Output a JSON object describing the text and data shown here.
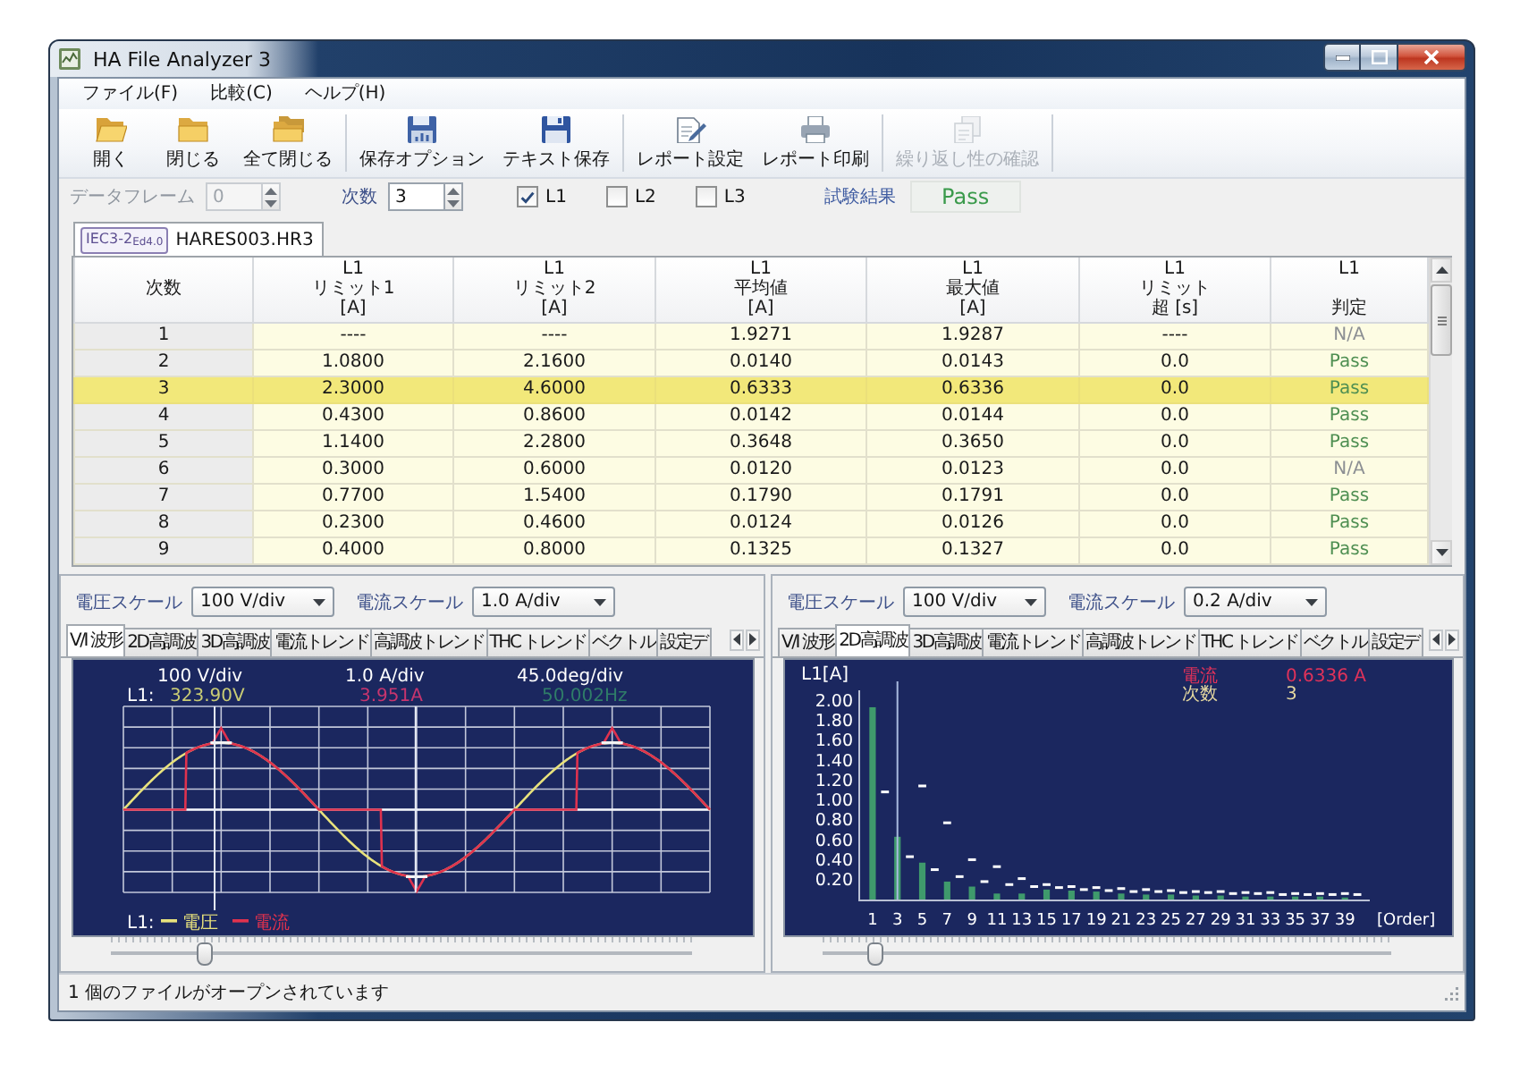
{
  "window": {
    "title": "HA File Analyzer 3"
  },
  "menu": [
    {
      "label": "ファイル(F)"
    },
    {
      "label": "比較(C)"
    },
    {
      "label": "ヘルプ(H)"
    }
  ],
  "toolbar": [
    {
      "buttons": [
        {
          "label": "開く",
          "kind": "open",
          "disabled": false
        },
        {
          "label": "閉じる",
          "kind": "folder",
          "disabled": false
        },
        {
          "label": "全て閉じる",
          "kind": "folders",
          "disabled": false
        }
      ]
    },
    {
      "buttons": [
        {
          "label": "保存オプション",
          "kind": "saveopt",
          "disabled": false
        },
        {
          "label": "テキスト保存",
          "kind": "save",
          "disabled": false
        }
      ]
    },
    {
      "buttons": [
        {
          "label": "レポート設定",
          "kind": "report",
          "disabled": false
        },
        {
          "label": "レポート印刷",
          "kind": "print",
          "disabled": false
        }
      ]
    },
    {
      "buttons": [
        {
          "label": "繰り返し性の確認",
          "kind": "repeat",
          "disabled": true
        }
      ]
    }
  ],
  "options": {
    "frame": {
      "label": "データフレーム",
      "value": "0",
      "disabled": true
    },
    "order": {
      "label": "次数",
      "value": "3",
      "disabled": false
    },
    "lines": [
      {
        "label": "L1",
        "checked": true
      },
      {
        "label": "L2",
        "checked": false
      },
      {
        "label": "L3",
        "checked": false
      }
    ],
    "result": {
      "label": "試験結果",
      "value": "Pass"
    }
  },
  "file_tabs": [
    {
      "standard": "IEC3-2$_{Ed4.0}$",
      "label": "HARES003.HR3",
      "selected": true
    }
  ],
  "table": {
    "columns": [
      {
        "lines": [
          "次数"
        ]
      },
      {
        "lines": [
          "L1",
          "リミット1",
          "[A]"
        ]
      },
      {
        "lines": [
          "L1",
          "リミット2",
          "[A]"
        ]
      },
      {
        "lines": [
          "L1",
          "平均値",
          "[A]"
        ]
      },
      {
        "lines": [
          "L1",
          "最大値",
          "[A]"
        ]
      },
      {
        "lines": [
          "L1",
          "リミット",
          "超 [s]"
        ]
      },
      {
        "lines": [
          "L1",
          "判定"
        ]
      }
    ],
    "rows": [
      {
        "cells": [
          "1",
          "----",
          "----",
          "1.9271",
          "1.9287",
          "----",
          "N/A"
        ],
        "color": "#8c8f93",
        "selected": false
      },
      {
        "cells": [
          "2",
          "1.0800",
          "2.1600",
          "0.0140",
          "0.0143",
          "0.0",
          "Pass"
        ],
        "color": "#4f8f52",
        "selected": false
      },
      {
        "cells": [
          "3",
          "2.3000",
          "4.6000",
          "0.6333",
          "0.6336",
          "0.0",
          "Pass"
        ],
        "color": "#4f8f52",
        "selected": true
      },
      {
        "cells": [
          "4",
          "0.4300",
          "0.8600",
          "0.0142",
          "0.0144",
          "0.0",
          "Pass"
        ],
        "color": "#4f8f52",
        "selected": false
      },
      {
        "cells": [
          "5",
          "1.1400",
          "2.2800",
          "0.3648",
          "0.3650",
          "0.0",
          "Pass"
        ],
        "color": "#4f8f52",
        "selected": false
      },
      {
        "cells": [
          "6",
          "0.3000",
          "0.6000",
          "0.0120",
          "0.0123",
          "0.0",
          "N/A"
        ],
        "color": "#8c8f93",
        "selected": false
      },
      {
        "cells": [
          "7",
          "0.7700",
          "1.5400",
          "0.1790",
          "0.1791",
          "0.0",
          "Pass"
        ],
        "color": "#4f8f52",
        "selected": false
      },
      {
        "cells": [
          "8",
          "0.2300",
          "0.4600",
          "0.0124",
          "0.0126",
          "0.0",
          "Pass"
        ],
        "color": "#4f8f52",
        "selected": false
      },
      {
        "cells": [
          "9",
          "0.4000",
          "0.8000",
          "0.1325",
          "0.1327",
          "0.0",
          "Pass"
        ],
        "color": "#4f8f52",
        "selected": false
      }
    ]
  },
  "panels": [
    {
      "kind": "waveform",
      "scales": [
        {
          "label": "電圧スケール",
          "value": "100 V/div"
        },
        {
          "label": "電流スケール",
          "value": "1.0 A/div"
        }
      ],
      "tabs": [
        {
          "label": "V/I 波形",
          "selected": true
        },
        {
          "label": "2D高調波",
          "selected": false
        },
        {
          "label": "3D高調波",
          "selected": false
        },
        {
          "label": "電流トレンド",
          "selected": false
        },
        {
          "label": "高調波トレンド",
          "selected": false
        },
        {
          "label": "THC トレンド",
          "selected": false
        },
        {
          "label": "ベクトル",
          "selected": false
        },
        {
          "label": "設定デ",
          "selected": false
        }
      ],
      "scope": {
        "divisions": [
          "100 V/div",
          "1.0 A/div",
          "45.0deg/div"
        ],
        "channel": "L1:",
        "readings": [
          {
            "text": "323.90V",
            "color": "#c9cc74"
          },
          {
            "text": "3.951A",
            "color": "#c7356e"
          },
          {
            "text": "50.002Hz",
            "color": "#2f7d68"
          }
        ],
        "legend": {
          "channel": "L1:",
          "items": [
            {
              "label": "電圧",
              "color": "#e8e27c"
            },
            {
              "label": "電流",
              "color": "#e0324e"
            }
          ]
        }
      },
      "slider": {
        "level": 0.16
      }
    },
    {
      "kind": "harmonics",
      "scales": [
        {
          "label": "電圧スケール",
          "value": "100 V/div"
        },
        {
          "label": "電流スケール",
          "value": "0.2 A/div"
        }
      ],
      "tabs": [
        {
          "label": "V/I 波形",
          "selected": false
        },
        {
          "label": "2D高調波",
          "selected": true
        },
        {
          "label": "3D高調波",
          "selected": false
        },
        {
          "label": "電流トレンド",
          "selected": false
        },
        {
          "label": "高調波トレンド",
          "selected": false
        },
        {
          "label": "THC トレンド",
          "selected": false
        },
        {
          "label": "ベクトル",
          "selected": false
        },
        {
          "label": "設定デ",
          "selected": false
        }
      ],
      "readout": [
        {
          "label": "電流",
          "value": "0.6336 A",
          "color": "#e0325a"
        },
        {
          "label": "次数",
          "value": "3",
          "color": "#e6d9a0"
        }
      ],
      "chart_data": {
        "type": "bar",
        "ylabel": "L1[A]",
        "xlabel": "[Order]",
        "x": [
          1,
          2,
          3,
          4,
          5,
          6,
          7,
          8,
          9,
          10,
          11,
          12,
          13,
          14,
          15,
          16,
          17,
          18,
          19,
          20,
          21,
          22,
          23,
          24,
          25,
          26,
          27,
          28,
          29,
          30,
          31,
          32,
          33,
          34,
          35,
          36,
          37,
          38,
          39,
          40
        ],
        "series": [
          {
            "color": "#3f9a6c",
            "values": [
              1.93,
              null,
              0.63,
              null,
              0.37,
              null,
              0.18,
              null,
              0.13,
              null,
              0.06,
              null,
              0.06,
              null,
              0.1,
              null,
              0.09,
              null,
              0.08,
              null,
              0.06,
              null,
              0.05,
              null,
              0.05,
              null,
              0.04,
              null,
              0.04,
              null,
              0.03,
              null,
              0.03,
              null,
              0.03,
              null,
              0.03,
              null,
              0.02,
              null
            ]
          },
          {
            "type": "scatter",
            "color": "#ffffff",
            "values": [
              null,
              1.08,
              null,
              0.43,
              1.14,
              0.3,
              0.77,
              0.23,
              0.4,
              0.18,
              0.33,
              0.15,
              0.21,
              0.13,
              0.15,
              0.12,
              0.13,
              0.1,
              0.12,
              0.09,
              0.11,
              0.08,
              0.1,
              0.08,
              0.09,
              0.07,
              0.08,
              0.07,
              0.08,
              0.06,
              0.07,
              0.06,
              0.07,
              0.05,
              0.06,
              0.05,
              0.06,
              0.05,
              0.06,
              0.05
            ]
          }
        ],
        "ref_lines": [
          {
            "axis": "x",
            "value": 3,
            "color": "#a9badf"
          }
        ],
        "xlim": [
          0,
          41
        ],
        "ylim": [
          0,
          2.1
        ],
        "xticks": [
          1,
          3,
          5,
          7,
          9,
          11,
          13,
          15,
          17,
          19,
          21,
          23,
          25,
          27,
          29,
          31,
          33,
          35,
          37,
          39
        ],
        "yticks": [
          {
            "value": 0.2,
            "label": "0.20"
          },
          {
            "value": 0.4,
            "label": "0.40"
          },
          {
            "value": 0.6,
            "label": "0.60"
          },
          {
            "value": 0.8,
            "label": "0.80"
          },
          {
            "value": 1.0,
            "label": "1.00"
          },
          {
            "value": 1.2,
            "label": "1.20"
          },
          {
            "value": 1.4,
            "label": "1.40"
          },
          {
            "value": 1.6,
            "label": "1.60"
          },
          {
            "value": 1.8,
            "label": "1.80"
          },
          {
            "value": 2.0,
            "label": "2.00"
          }
        ]
      },
      "slider": {
        "level": 0.09
      }
    }
  ],
  "status_bar": {
    "text": "1 個のファイルがオープンされています"
  }
}
